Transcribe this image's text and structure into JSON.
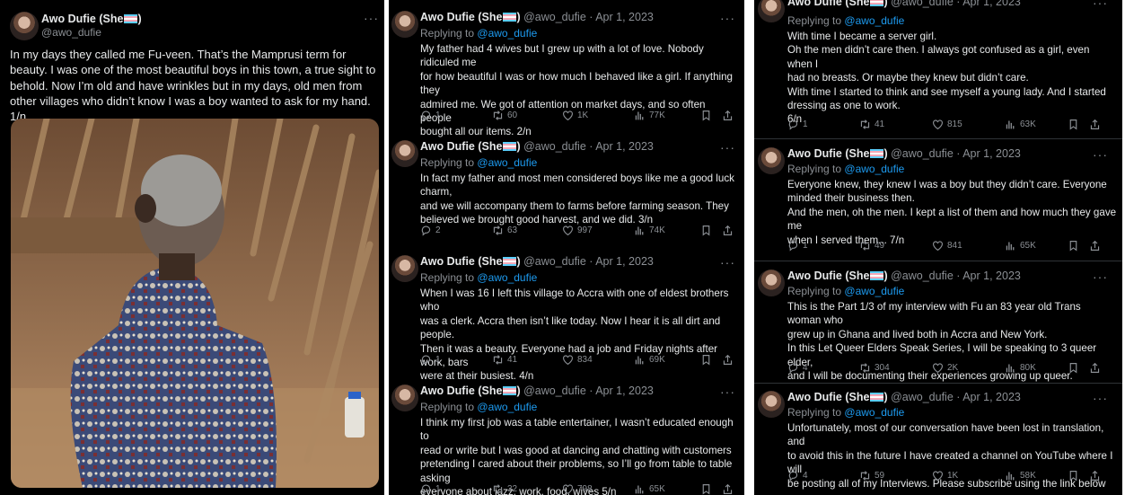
{
  "author": {
    "name": "Awo Dufie (She",
    "handle": "@awo_dufie",
    "date": "Apr 1, 2023"
  },
  "main_tweet": {
    "name": "Awo Dufie (She",
    "handle": "@awo_dufie",
    "text": "In my days they called me Fu-veen. That’s the Mamprusi term for beauty. I was one of the most beautiful boys in this town, a true sight to behold. Now I’m old and have wrinkles but in my days, old men from other villages who didn’t know I was a boy wanted to ask for my hand. 1/n"
  },
  "replying_label": "Replying to",
  "more_icon": "more-icon",
  "tweets": [
    {
      "text": "My father had 4 wives but I grew up with a lot of love. Nobody ridiculed me\nfor how beautiful I was or how much I behaved like a girl. If anything they\nadmired me. We got of attention on market days, and so often people\nbought all our items. 2/n",
      "replies": "1",
      "retweets": "60",
      "likes": "1K",
      "views": "77K"
    },
    {
      "text": "In fact my father and most men considered boys like me a good luck charm,\nand we will accompany them to farms before farming season. They\nbelieved we brought good harvest, and we did.  3/n",
      "replies": "2",
      "retweets": "63",
      "likes": "997",
      "views": "74K"
    },
    {
      "text": "When I was 16 I left this village to Accra with one of eldest brothers who\nwas a clerk. Accra then isn’t like today. Now I hear it is all dirt and people.\nThen it was a beauty. Everyone had a job and Friday nights after work, bars\nwere at their busiest. 4/n",
      "replies": "1",
      "retweets": "41",
      "likes": "834",
      "views": "69K"
    },
    {
      "text": "I think my first job was a table entertainer, I wasn’t educated enough to\nread or write but I was good at dancing and chatting with customers\npretending I cared about their problems, so I’ll go from table to table asking\neveryone about jazz, work, food, wives  5/n",
      "replies": "1",
      "retweets": "32",
      "likes": "798",
      "views": "65K"
    },
    {
      "text": "With time I became a server girl.\nOh the men didn’t care then. I always got confused as a girl, even when I\nhad no breasts. Or maybe they knew but didn’t care.\nWith time I started to think and see myself a young lady. And I started\ndressing as one to work.\n6/n",
      "replies": "1",
      "retweets": "41",
      "likes": "815",
      "views": "63K"
    },
    {
      "text": "Everyone knew, they knew I was a boy but they didn’t care. Everyone\nminded their business then.\nAnd the men, oh the men. I kept a list of them and how much they gave me\nwhen I served them... 7/n",
      "replies": "1",
      "retweets": "49",
      "likes": "841",
      "views": "65K"
    },
    {
      "text": "This is the Part 1/3 of my interview with Fu an 83 year old Trans woman who\ngrew up in Ghana and lived both in Accra and New York.\nIn this Let Queer Elders Speak Series, I will be speaking to 3 queer elder,\nand I will be documenting their experiences growing up queer.",
      "replies": "4",
      "retweets": "304",
      "likes": "2K",
      "views": "80K"
    },
    {
      "text": "Unfortunately, most of our conversation have been lost in translation, and\nto avoid this in the future I have created a channel on YouTube where I will\nbe posting all of my Interviews. Please subscribe using the link below",
      "replies": "4",
      "retweets": "59",
      "likes": "1K",
      "views": "58K"
    }
  ]
}
